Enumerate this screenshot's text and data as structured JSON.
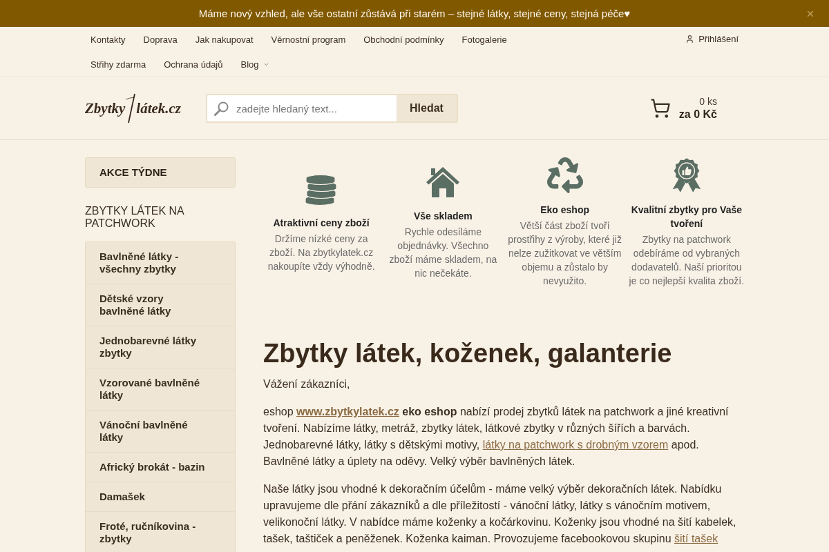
{
  "banner": {
    "text": "Máme nový vzhled, ale vše ostatní zůstává při starém – stejné látky, stejné ceny, stejná péče♥"
  },
  "nav": {
    "items": [
      {
        "label": "Kontakty",
        "dropdown": false
      },
      {
        "label": "Doprava",
        "dropdown": false
      },
      {
        "label": "Jak nakupovat",
        "dropdown": false
      },
      {
        "label": "Věrnostní program",
        "dropdown": false
      },
      {
        "label": "Obchodní podmínky",
        "dropdown": false
      },
      {
        "label": "Fotogalerie",
        "dropdown": false
      },
      {
        "label": "Střihy zdarma",
        "dropdown": false
      },
      {
        "label": "Ochrana údajů",
        "dropdown": false
      },
      {
        "label": "Blog",
        "dropdown": true
      }
    ],
    "login": "Přihlášení"
  },
  "header": {
    "logo": {
      "text_left": "Zbytky",
      "text_right": "látek.cz"
    },
    "search": {
      "placeholder": "zadejte hledaný text...",
      "button": "Hledat"
    },
    "cart": {
      "count": "0 ks",
      "total": "za 0 Kč"
    }
  },
  "sidebar": {
    "promo": "AKCE TÝDNE",
    "heading": "ZBYTKY LÁTEK NA PATCHWORK",
    "categories": [
      "Bavlněné látky - všechny zbytky",
      "Dětské vzory bavlněné látky",
      "Jednobarevné látky zbytky",
      "Vzorované bavlněné látky",
      "Vánoční bavlněné látky",
      "Africký brokát - bazin",
      "Damašek",
      "Froté, ručníkovina - zbytky"
    ]
  },
  "features": [
    {
      "title": "Atraktivní ceny zboží",
      "text": "Držíme nízké ceny za zboží. Na zbytkylatek.cz nakoupíte vždy výhodně."
    },
    {
      "title": "Vše skladem",
      "text": "Rychle odesíláme objednávky. Všechno zboží máme skladem, na nic nečekáte."
    },
    {
      "title": "Eko eshop",
      "text": "Větší část zboží tvoří prostřihy z výroby, které již nelze zužitkovat ve větším objemu a zůstalo by nevyužito."
    },
    {
      "title": "Kvalitní zbytky pro Vaše tvoření",
      "text": "Zbytky na patchwork odebíráme od vybraných dodavatelů. Naší prioritou je co nejlepší kvalita zboží."
    }
  ],
  "article": {
    "title": "Zbytky látek, koženek, galanterie",
    "greeting": "Vážení zákazníci,",
    "paragraphs": [
      [
        {
          "kind": "text",
          "text": "eshop "
        },
        {
          "kind": "link",
          "text": "www.zbytkylatek.cz",
          "bold": true
        },
        {
          "kind": "text",
          "text": " **eko eshop** nabízí prodej zbytků látek na patchwork a jiné kreativní tvoření. Nabízíme látky, metráž, zbytky látek, látkové zbytky v různých šířích a barvách. Jednobarevné látky, látky s dětskými motivy, "
        },
        {
          "kind": "link",
          "text": "látky na patchwork s drobným vzorem",
          "bold": false
        },
        {
          "kind": "text",
          "text": " apod. Bavlněné látky a úplety na oděvy. Velký výběr bavlněných látek."
        }
      ],
      [
        {
          "kind": "text",
          "text": "Naše látky jsou vhodné k dekoračním účelům - máme velký výběr dekoračních látek. Nabídku upravujeme dle přání zákazníků a dle příležitostí - vánoční látky, látky s vánočním motivem, velikonoční látky. V nabídce máme koženky a kočárkovinu. Koženky jsou vhodné na šití kabelek, tašek, taštiček a peněženek. Koženka kaiman. Provozujeme facebookovou skupinu "
        },
        {
          "kind": "link",
          "text": "šití tašek",
          "bold": false
        }
      ]
    ]
  }
}
